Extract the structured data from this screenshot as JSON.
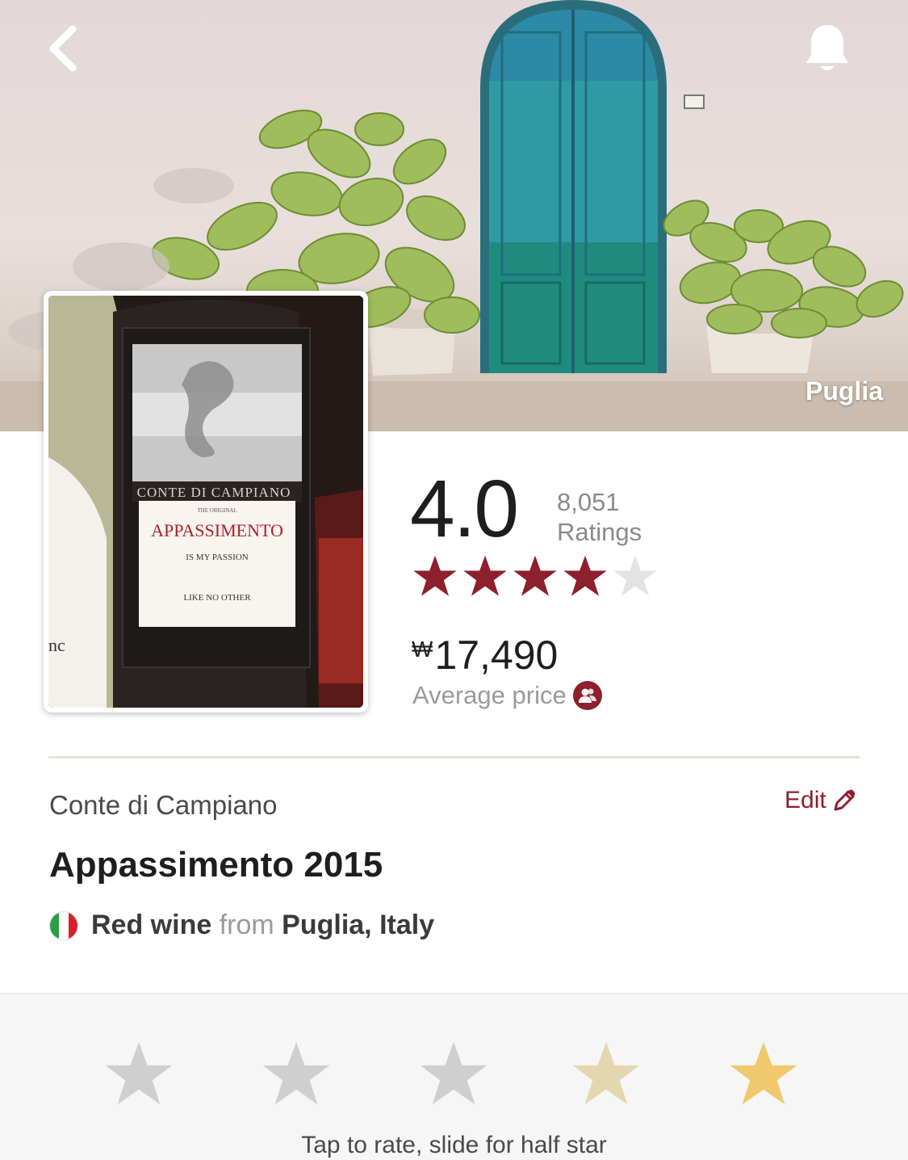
{
  "header": {
    "back_icon": "chevron-left-icon",
    "notify_icon": "bell-icon",
    "region_label": "Puglia"
  },
  "bottle_label": {
    "brand": "CONTE DI CAMPIANO",
    "small_text": "THE ORIGINAL",
    "name": "APPASSIMENTO",
    "line1": "IS MY PASSION",
    "line2": "LIKE NO OTHER"
  },
  "rating": {
    "average": "4.0",
    "count": "8,051",
    "count_label": "Ratings",
    "stars_filled": 4,
    "stars_total": 5,
    "star_color": "#8e1f2c",
    "star_empty_color": "#e3e3e3"
  },
  "price": {
    "currency": "₩",
    "amount": "17,490",
    "label": "Average price",
    "info_icon": "community-icon"
  },
  "wine": {
    "winery": "Conte di Campiano",
    "edit_label": "Edit",
    "edit_icon": "pencil-icon",
    "name": "Appassimento 2015",
    "type": "Red wine",
    "from_word": "from",
    "origin": "Puglia, Italy",
    "flag_icon": "italy-flag-icon",
    "flag_colors": [
      "#2e9b47",
      "#ffffff",
      "#d6202c"
    ]
  },
  "rate_panel": {
    "star_count": 5,
    "star_colors": [
      "#cfcfcf",
      "#cfcfcf",
      "#cfcfcf",
      "#e4d7b0",
      "#efc96c"
    ],
    "hint": "Tap to rate, slide for half star"
  }
}
